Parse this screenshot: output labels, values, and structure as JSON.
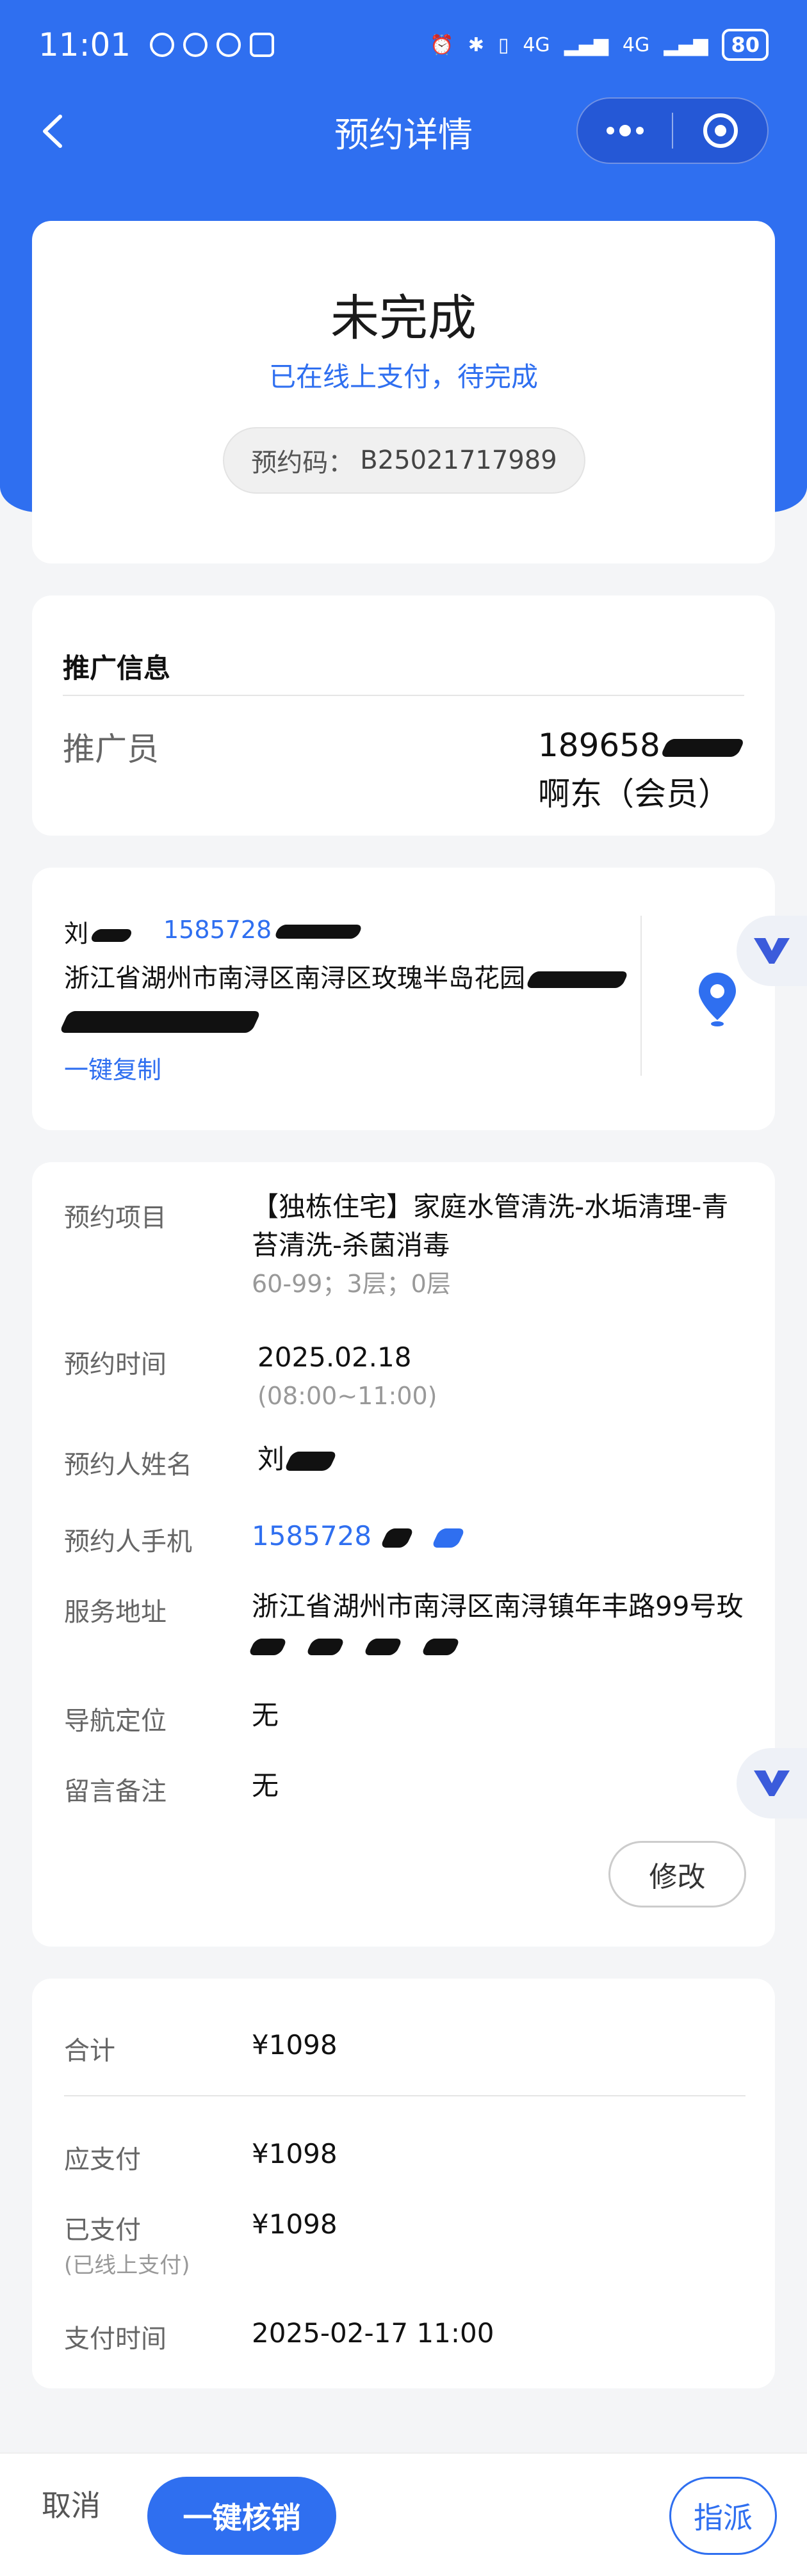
{
  "status_bar": {
    "time": "11:01",
    "network_label": "4G",
    "network_label_2": "4G",
    "battery": "80"
  },
  "nav": {
    "title": "预约详情"
  },
  "status_card": {
    "title": "未完成",
    "subtitle": "已在线上支付，待完成",
    "code_label": "预约码：",
    "code_value": "B25021717989"
  },
  "promo": {
    "title": "推广信息",
    "label": "推广员",
    "phone": "189658",
    "name": "啊东（会员）"
  },
  "address_card": {
    "name": "刘",
    "phone": "1585728",
    "address": "浙江省湖州市南浔区南浔区玫瑰半岛花园",
    "copy_label": "一键复制"
  },
  "details": {
    "project_label": "预约项目",
    "project_value": "【独栋住宅】家庭水管清洗-水垢清理-青苔清洗-杀菌消毒",
    "project_sub": "60-99；3层；0层",
    "time_label": "预约时间",
    "date_value": "2025.02.18",
    "time_range": "(08:00~11:00)",
    "name_label": "预约人姓名",
    "name_value": "刘",
    "phone_label": "预约人手机",
    "phone_value": "1585728",
    "address_label": "服务地址",
    "address_value": "浙江省湖州市南浔区南浔镇年丰路99号玫",
    "nav_label": "导航定位",
    "nav_value": "无",
    "note_label": "留言备注",
    "note_value": "无",
    "edit_button": "修改"
  },
  "payment": {
    "total_label": "合计",
    "total_value": "¥1098",
    "due_label": "应支付",
    "due_value": "¥1098",
    "paid_label": "已支付",
    "paid_sub": "(已线上支付)",
    "paid_value": "¥1098",
    "paytime_label": "支付时间",
    "paytime_value": "2025-02-17 11:00"
  },
  "bottom_bar": {
    "cancel": "取消",
    "verify": "一键核销",
    "assign": "指派"
  },
  "colors": {
    "primary": "#2f6ff0",
    "background": "#f4f5f7"
  }
}
